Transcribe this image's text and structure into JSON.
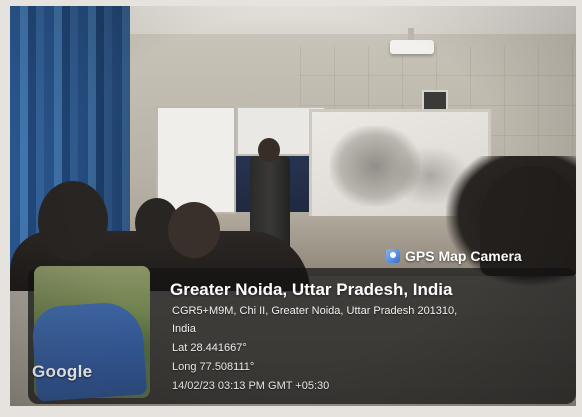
{
  "photo": {
    "scene": ""
  },
  "overlay": {
    "badge_label": "GPS Map Camera",
    "badge_icon": "map-camera-icon",
    "location_title": "Greater Noida, Uttar Pradesh, India",
    "address_line1": "CGR5+M9M, Chi II, Greater Noida, Uttar Pradesh 201310,",
    "address_line2": "India",
    "latitude": "Lat 28.441667°",
    "longitude": "Long 77.508111°",
    "datetime": "14/02/23 03:13 PM GMT +05:30",
    "map_watermark": "Google"
  }
}
